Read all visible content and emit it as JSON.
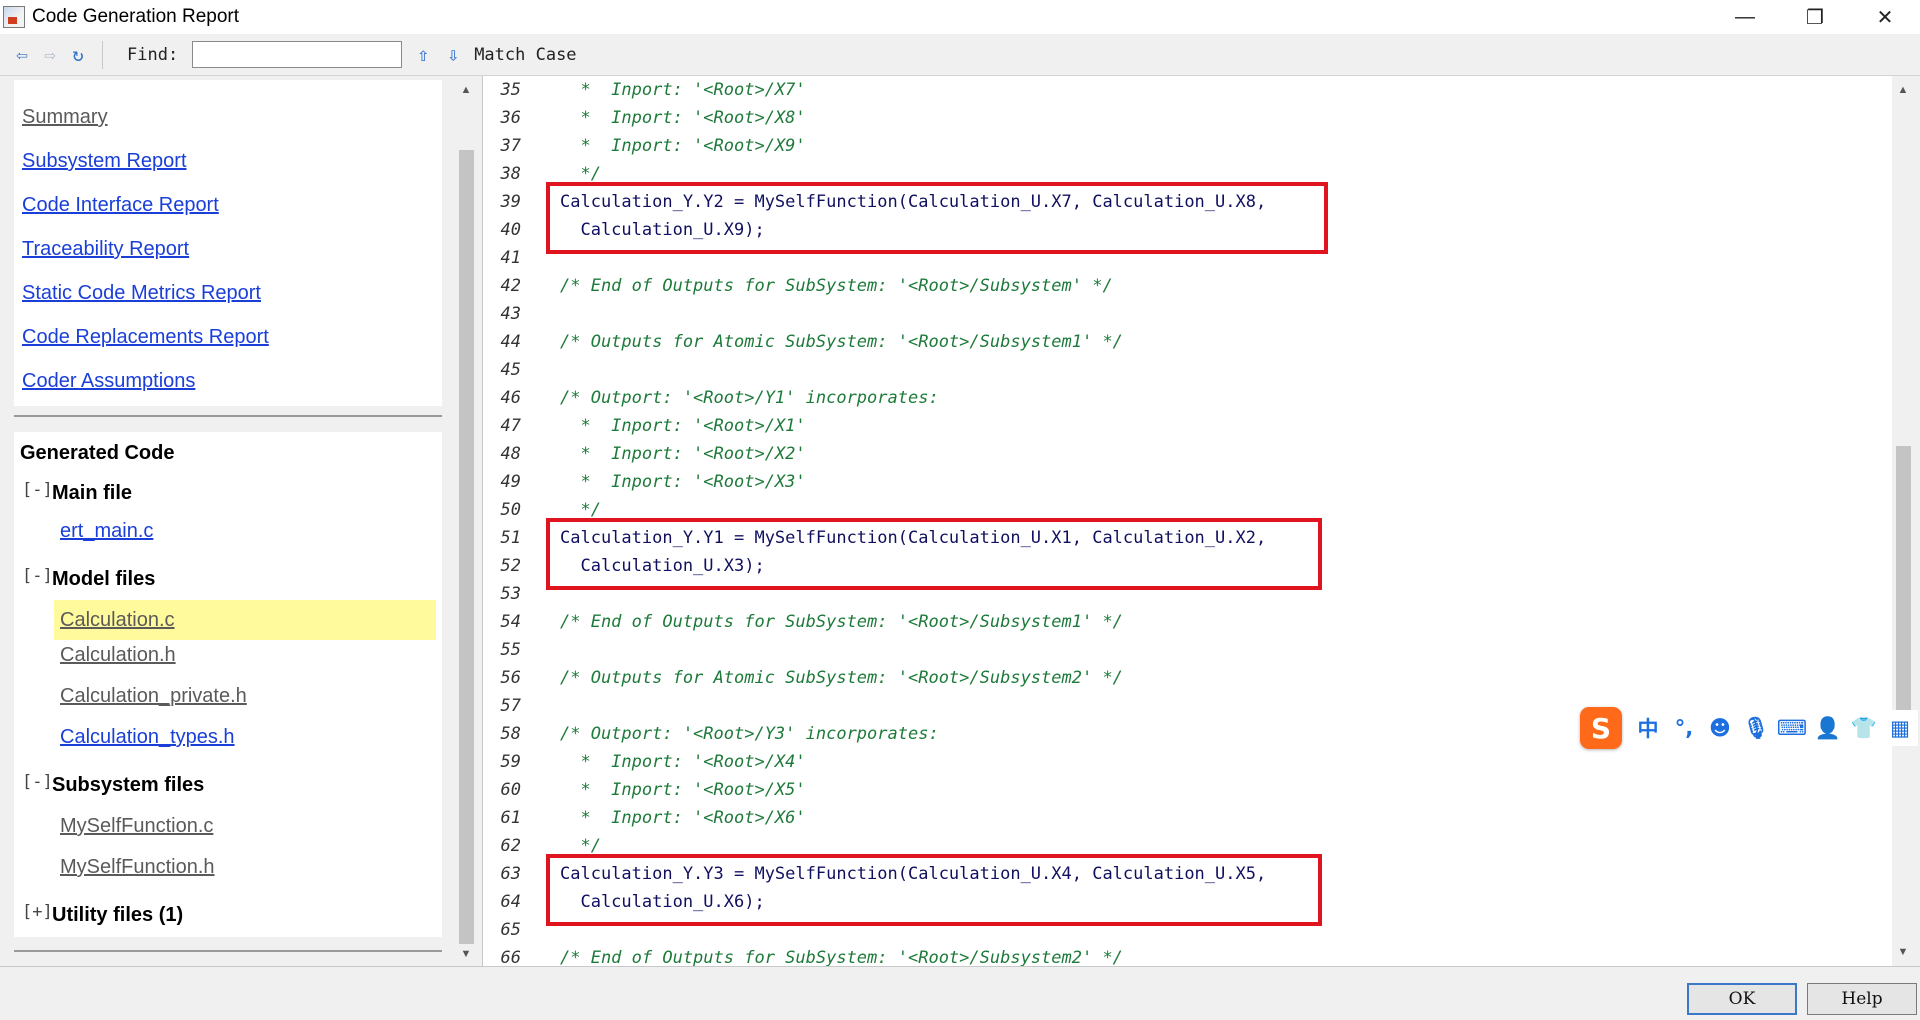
{
  "window": {
    "title": "Code Generation Report",
    "controls": {
      "minimize": "—",
      "maximize": "❐",
      "close": "✕"
    }
  },
  "toolbar": {
    "back_icon": "⇦",
    "forward_icon": "⇨",
    "refresh_icon": "↻",
    "find_label": "Find:",
    "find_value": "",
    "find_up_icon": "⇧",
    "find_down_icon": "⇩",
    "match_case_label": "Match Case"
  },
  "nav": {
    "links": [
      {
        "label": "Summary",
        "visited": true
      },
      {
        "label": "Subsystem Report",
        "visited": false
      },
      {
        "label": "Code Interface Report",
        "visited": false
      },
      {
        "label": "Traceability Report",
        "visited": false
      },
      {
        "label": "Static Code Metrics Report",
        "visited": false
      },
      {
        "label": "Code Replacements Report",
        "visited": false
      },
      {
        "label": "Coder Assumptions",
        "visited": false
      }
    ]
  },
  "generated_code": {
    "title": "Generated Code",
    "main_file": {
      "toggle": "[-]",
      "label": "Main file",
      "files": [
        "ert_main.c"
      ]
    },
    "model_files": {
      "toggle": "[-]",
      "label": "Model files",
      "files": [
        "Calculation.c",
        "Calculation.h",
        "Calculation_private.h",
        "Calculation_types.h"
      ],
      "selected": "Calculation.c"
    },
    "subsystem_files": {
      "toggle": "[-]",
      "label": "Subsystem files",
      "files": [
        "MySelfFunction.c",
        "MySelfFunction.h"
      ]
    },
    "utility_files": {
      "toggle": "[+]",
      "label": "Utility files (1)"
    }
  },
  "code": {
    "lines": [
      {
        "n": "35",
        "text": "  *  Inport: '<Root>/X7'",
        "kind": "comment"
      },
      {
        "n": "36",
        "text": "  *  Inport: '<Root>/X8'",
        "kind": "comment"
      },
      {
        "n": "37",
        "text": "  *  Inport: '<Root>/X9'",
        "kind": "comment"
      },
      {
        "n": "38",
        "text": "  */",
        "kind": "comment"
      },
      {
        "n": "39",
        "text": "Calculation_Y.Y2 = MySelfFunction(Calculation_U.X7, Calculation_U.X8,",
        "kind": "code"
      },
      {
        "n": "40",
        "text": "  Calculation_U.X9);",
        "kind": "code"
      },
      {
        "n": "41",
        "text": "",
        "kind": "code"
      },
      {
        "n": "42",
        "text": "/* End of Outputs for SubSystem: '<Root>/Subsystem' */",
        "kind": "comment"
      },
      {
        "n": "43",
        "text": "",
        "kind": "code"
      },
      {
        "n": "44",
        "text": "/* Outputs for Atomic SubSystem: '<Root>/Subsystem1' */",
        "kind": "comment"
      },
      {
        "n": "45",
        "text": "",
        "kind": "code"
      },
      {
        "n": "46",
        "text": "/* Outport: '<Root>/Y1' incorporates:",
        "kind": "comment"
      },
      {
        "n": "47",
        "text": "  *  Inport: '<Root>/X1'",
        "kind": "comment"
      },
      {
        "n": "48",
        "text": "  *  Inport: '<Root>/X2'",
        "kind": "comment"
      },
      {
        "n": "49",
        "text": "  *  Inport: '<Root>/X3'",
        "kind": "comment"
      },
      {
        "n": "50",
        "text": "  */",
        "kind": "comment"
      },
      {
        "n": "51",
        "text": "Calculation_Y.Y1 = MySelfFunction(Calculation_U.X1, Calculation_U.X2,",
        "kind": "code"
      },
      {
        "n": "52",
        "text": "  Calculation_U.X3);",
        "kind": "code"
      },
      {
        "n": "53",
        "text": "",
        "kind": "code"
      },
      {
        "n": "54",
        "text": "/* End of Outputs for SubSystem: '<Root>/Subsystem1' */",
        "kind": "comment"
      },
      {
        "n": "55",
        "text": "",
        "kind": "code"
      },
      {
        "n": "56",
        "text": "/* Outputs for Atomic SubSystem: '<Root>/Subsystem2' */",
        "kind": "comment"
      },
      {
        "n": "57",
        "text": "",
        "kind": "code"
      },
      {
        "n": "58",
        "text": "/* Outport: '<Root>/Y3' incorporates:",
        "kind": "comment"
      },
      {
        "n": "59",
        "text": "  *  Inport: '<Root>/X4'",
        "kind": "comment"
      },
      {
        "n": "60",
        "text": "  *  Inport: '<Root>/X5'",
        "kind": "comment"
      },
      {
        "n": "61",
        "text": "  *  Inport: '<Root>/X6'",
        "kind": "comment"
      },
      {
        "n": "62",
        "text": "  */",
        "kind": "comment"
      },
      {
        "n": "63",
        "text": "Calculation_Y.Y3 = MySelfFunction(Calculation_U.X4, Calculation_U.X5,",
        "kind": "code"
      },
      {
        "n": "64",
        "text": "  Calculation_U.X6);",
        "kind": "code"
      },
      {
        "n": "65",
        "text": "",
        "kind": "code"
      },
      {
        "n": "66",
        "text": "/* End of Outputs for SubSystem: '<Root>/Subsystem2' */",
        "kind": "comment"
      }
    ]
  },
  "ime": {
    "logo": "S",
    "items": [
      {
        "icon": "中",
        "name": "chinese-mode-icon"
      },
      {
        "icon": "°,",
        "name": "punctuation-icon"
      },
      {
        "icon": "☻",
        "name": "emoji-icon"
      },
      {
        "icon": "🎙",
        "name": "microphone-icon"
      },
      {
        "icon": "⌨",
        "name": "keyboard-icon"
      },
      {
        "icon": "👤",
        "name": "user-icon"
      },
      {
        "icon": "👕",
        "name": "skin-icon"
      },
      {
        "icon": "▦",
        "name": "apps-icon"
      }
    ]
  },
  "buttons": {
    "ok": "OK",
    "help": "Help"
  },
  "colors": {
    "link": "#1a3fd8",
    "visited_link": "#5a5a5a",
    "selection": "#fffa9c",
    "comment": "#1e7a3a",
    "code": "#101060",
    "highlight_border": "#e0141e",
    "ime_accent": "#ff6a1a"
  }
}
